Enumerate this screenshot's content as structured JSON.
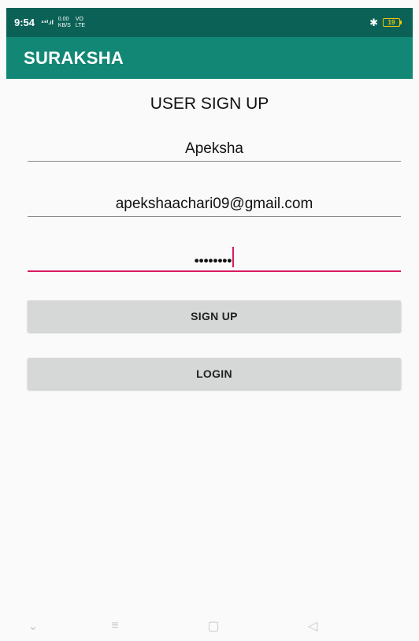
{
  "status_bar": {
    "time": "9:54",
    "signal": "⁴⁶ᴵ.ıl",
    "speed_value": "0.00",
    "speed_unit": "KB/S",
    "net_top": "VO",
    "net_bottom": "LTE",
    "bluetooth": "✱",
    "battery_level": "19"
  },
  "app_bar": {
    "title": "SURAKSHA"
  },
  "form": {
    "title": "USER SIGN UP",
    "name_value": "Apeksha",
    "email_value": "apekshaachari09@gmail.com",
    "password_masked": "••••••••"
  },
  "buttons": {
    "signup_label": "SIGN UP",
    "login_label": "LOGIN"
  },
  "nav": {
    "down": "⌄",
    "menu": "≡",
    "home": "▢",
    "back": "◁"
  },
  "colors": {
    "status_bar": "#0b6156",
    "app_bar": "#128776",
    "accent": "#d81b60",
    "button": "#d6d7d7"
  }
}
